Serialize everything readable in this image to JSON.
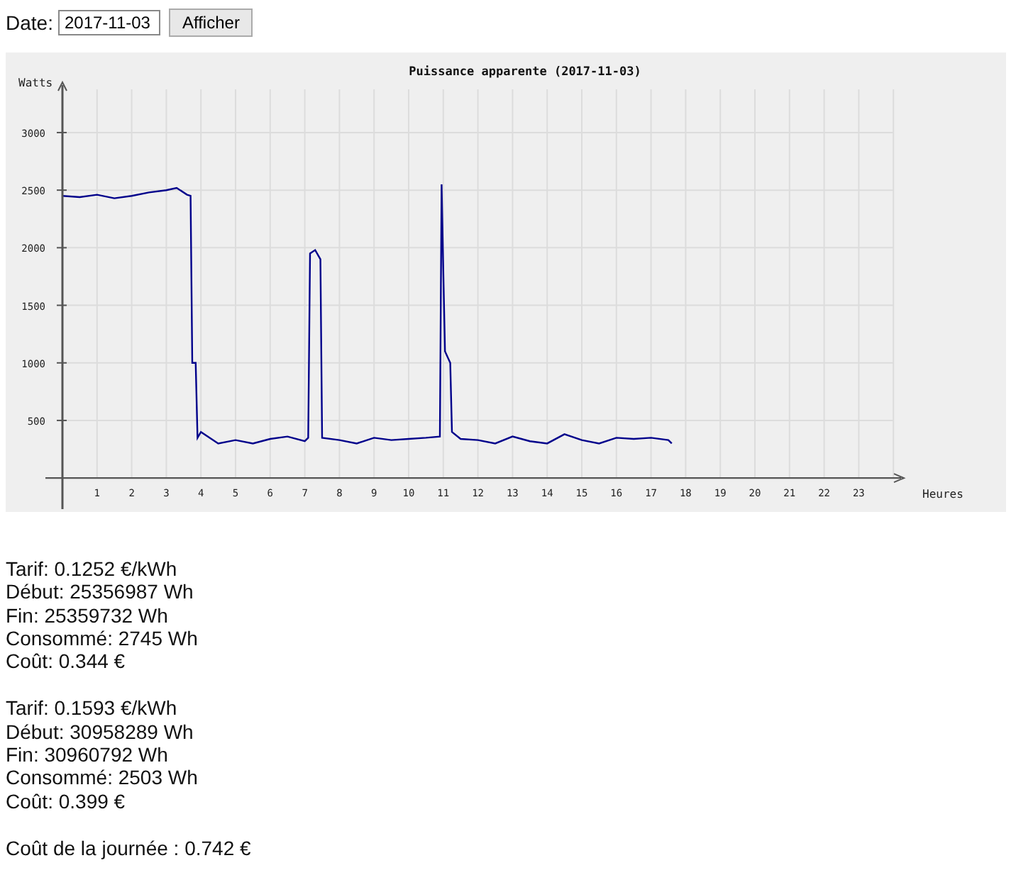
{
  "form": {
    "label": "Date:",
    "date": "2017-11-03",
    "button": "Afficher"
  },
  "chart": {
    "chart_data": {
      "type": "line",
      "title": "Puissance apparente (2017-11-03)",
      "xlabel": "Heures",
      "ylabel": "Watts",
      "x": [
        0,
        0.5,
        1,
        1.5,
        2,
        2.5,
        3,
        3.3,
        3.6,
        3.7,
        3.75,
        3.85,
        3.9,
        4,
        4.5,
        5,
        5.5,
        6,
        6.5,
        7,
        7.1,
        7.15,
        7.3,
        7.45,
        7.5,
        8,
        8.5,
        9,
        9.5,
        10,
        10.5,
        10.9,
        10.95,
        11,
        11.05,
        11.2,
        11.25,
        11.5,
        12,
        12.5,
        13,
        13.5,
        14,
        14.5,
        15,
        15.5,
        16,
        16.5,
        17,
        17.5,
        17.6
      ],
      "series": [
        {
          "color": "#00008b",
          "values": [
            2450,
            2440,
            2460,
            2430,
            2450,
            2480,
            2500,
            2520,
            2460,
            2450,
            1000,
            1000,
            350,
            400,
            300,
            330,
            300,
            340,
            360,
            320,
            350,
            1950,
            1980,
            1900,
            350,
            330,
            300,
            350,
            330,
            340,
            350,
            360,
            2550,
            1800,
            1100,
            1000,
            400,
            340,
            330,
            300,
            360,
            320,
            300,
            380,
            330,
            300,
            350,
            340,
            350,
            330,
            300
          ]
        }
      ],
      "xlim": [
        0,
        24
      ],
      "ylim": [
        -270,
        3400
      ],
      "grid": true,
      "xticks": [
        1,
        2,
        3,
        4,
        5,
        6,
        7,
        8,
        9,
        10,
        11,
        12,
        13,
        14,
        15,
        16,
        17,
        18,
        19,
        20,
        21,
        22,
        23
      ],
      "yticks": [
        500,
        1000,
        1500,
        2000,
        2500,
        3000
      ]
    }
  },
  "tariffs": [
    {
      "lines": [
        "Tarif: 0.1252 €/kWh",
        "Début: 25356987 Wh",
        "Fin: 25359732 Wh",
        "Consommé: 2745 Wh",
        "Coût: 0.344 €"
      ]
    },
    {
      "lines": [
        "Tarif: 0.1593 €/kWh",
        "Début: 30958289 Wh",
        "Fin: 30960792 Wh",
        "Consommé: 2503 Wh",
        "Coût: 0.399 €"
      ]
    }
  ],
  "total": "Coût de la journée : 0.742 €"
}
